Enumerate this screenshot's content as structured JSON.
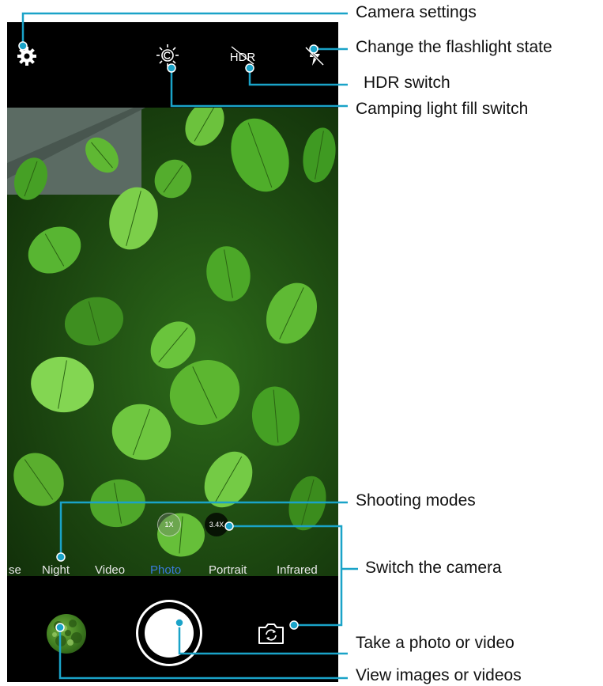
{
  "top_bar": {
    "settings_icon": "gear-icon",
    "fill_light_icon": "sun-icon",
    "hdr_label": "HDR",
    "flash_icon": "flash-off-icon"
  },
  "zoom": {
    "levels": [
      "1X",
      "3.4X"
    ],
    "selected": "3.4X"
  },
  "modes": {
    "items": [
      "se",
      "Night",
      "Video",
      "Photo",
      "Portrait",
      "Infrared"
    ],
    "active": "Photo"
  },
  "controls": {
    "gallery_icon": "gallery-thumbnail",
    "shutter_icon": "shutter-button",
    "switch_icon": "camera-switch-icon"
  },
  "callouts": {
    "settings": "Camera settings",
    "flash": "Change the flashlight state",
    "hdr": "HDR switch",
    "fill_light": "Camping light fill switch",
    "modes": "Shooting modes",
    "switch": "Switch the camera",
    "shutter": "Take a photo or video",
    "gallery": "View images  or videos"
  },
  "colors": {
    "leader_line": "#1aa3c8",
    "active_mode": "#3a7bdc",
    "phone_bg": "#000000"
  }
}
